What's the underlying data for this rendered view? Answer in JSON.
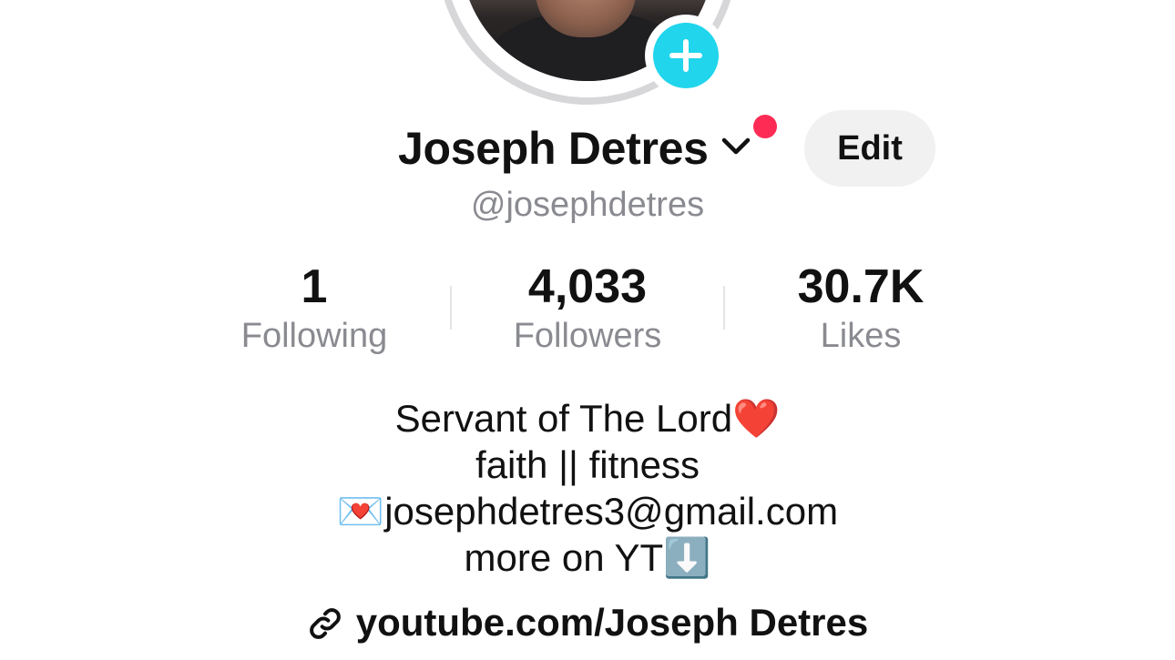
{
  "profile": {
    "display_name": "Joseph Detres",
    "username": "@josephdetres",
    "edit_label": "Edit"
  },
  "stats": [
    {
      "value": "1",
      "label": "Following"
    },
    {
      "value": "4,033",
      "label": "Followers"
    },
    {
      "value": "30.7K",
      "label": "Likes"
    }
  ],
  "bio": {
    "line1_text": "Servant of The Lord",
    "line1_emoji": "❤️",
    "line2_text": "faith || fitness",
    "line3_emoji": "💌",
    "line3_text": "josephdetres3@gmail.com",
    "line4_text": "more on YT",
    "line4_emoji": "⬇️"
  },
  "link": {
    "text": "youtube.com/Joseph Detres"
  },
  "icons": {
    "add_story": "plus-icon",
    "account_switch": "chevron-down-icon",
    "link": "link-icon"
  },
  "colors": {
    "accent_cyan": "#20d5ec",
    "notification_red": "#fe2c55",
    "secondary_text": "#8a8b91",
    "button_bg": "#f1f1f2"
  }
}
